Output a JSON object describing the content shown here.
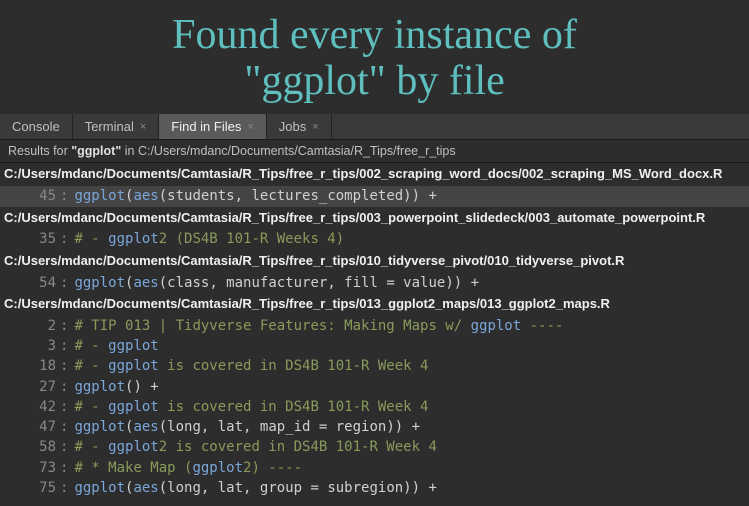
{
  "annotation": {
    "line1": "Found every instance of",
    "line2": "\"ggplot\" by file"
  },
  "tabs": [
    {
      "label": "Console",
      "closable": false,
      "active": false
    },
    {
      "label": "Terminal",
      "closable": true,
      "active": false
    },
    {
      "label": "Find in Files",
      "closable": true,
      "active": true
    },
    {
      "label": "Jobs",
      "closable": true,
      "active": false
    }
  ],
  "search": {
    "prefix": "Results for ",
    "query": "\"ggplot\"",
    "in": " in ",
    "path": "C:/Users/mdanc/Documents/Camtasia/R_Tips/free_r_tips"
  },
  "results": [
    {
      "file": "C:/Users/mdanc/Documents/Camtasia/R_Tips/free_r_tips/002_scraping_word_docs/002_scraping_MS_Word_docx.R",
      "lines": [
        {
          "n": 45,
          "highlight": true,
          "tokens": [
            {
              "t": "ggplot",
              "c": "fn"
            },
            {
              "t": "(",
              "c": "paren"
            },
            {
              "t": "aes",
              "c": "fn"
            },
            {
              "t": "(students, lectures_completed)) +",
              "c": "code"
            }
          ]
        }
      ]
    },
    {
      "file": "C:/Users/mdanc/Documents/Camtasia/R_Tips/free_r_tips/003_powerpoint_slidedeck/003_automate_powerpoint.R",
      "lines": [
        {
          "n": 35,
          "highlight": false,
          "tokens": [
            {
              "t": "# - ",
              "c": "cmt"
            },
            {
              "t": "ggplot",
              "c": "kw-match"
            },
            {
              "t": "2 (DS4B 101-R Weeks 4)",
              "c": "cmt"
            }
          ]
        }
      ]
    },
    {
      "file": "C:/Users/mdanc/Documents/Camtasia/R_Tips/free_r_tips/010_tidyverse_pivot/010_tidyverse_pivot.R",
      "lines": [
        {
          "n": 54,
          "highlight": false,
          "tokens": [
            {
              "t": "ggplot",
              "c": "fn"
            },
            {
              "t": "(",
              "c": "paren"
            },
            {
              "t": "aes",
              "c": "fn"
            },
            {
              "t": "(class, manufacturer, fill = value)) +",
              "c": "code"
            }
          ]
        }
      ]
    },
    {
      "file": "C:/Users/mdanc/Documents/Camtasia/R_Tips/free_r_tips/013_ggplot2_maps/013_ggplot2_maps.R",
      "lines": [
        {
          "n": 2,
          "highlight": false,
          "tokens": [
            {
              "t": "# TIP 013 | Tidyverse Features: Making Maps w/ ",
              "c": "cmt"
            },
            {
              "t": "ggplot",
              "c": "kw-match"
            },
            {
              "t": " ----",
              "c": "cmt"
            }
          ]
        },
        {
          "n": 3,
          "highlight": false,
          "tokens": [
            {
              "t": "# - ",
              "c": "cmt"
            },
            {
              "t": "ggplot",
              "c": "kw-match"
            }
          ]
        },
        {
          "n": 18,
          "highlight": false,
          "tokens": [
            {
              "t": "# - ",
              "c": "cmt"
            },
            {
              "t": "ggplot",
              "c": "kw-match"
            },
            {
              "t": " is covered in DS4B 101-R Week 4",
              "c": "cmt"
            }
          ]
        },
        {
          "n": 27,
          "highlight": false,
          "tokens": [
            {
              "t": "ggplot",
              "c": "fn"
            },
            {
              "t": "() +",
              "c": "code"
            }
          ]
        },
        {
          "n": 42,
          "highlight": false,
          "tokens": [
            {
              "t": "# - ",
              "c": "cmt"
            },
            {
              "t": "ggplot",
              "c": "kw-match"
            },
            {
              "t": " is covered in DS4B 101-R Week 4",
              "c": "cmt"
            }
          ]
        },
        {
          "n": 47,
          "highlight": false,
          "tokens": [
            {
              "t": "ggplot",
              "c": "fn"
            },
            {
              "t": "(",
              "c": "paren"
            },
            {
              "t": "aes",
              "c": "fn"
            },
            {
              "t": "(long, lat, map_id = region)) +",
              "c": "code"
            }
          ]
        },
        {
          "n": 58,
          "highlight": false,
          "tokens": [
            {
              "t": "# - ",
              "c": "cmt"
            },
            {
              "t": "ggplot",
              "c": "kw-match"
            },
            {
              "t": "2 is covered in DS4B 101-R Week 4",
              "c": "cmt"
            }
          ]
        },
        {
          "n": 73,
          "highlight": false,
          "tokens": [
            {
              "t": "# * Make Map (",
              "c": "cmt"
            },
            {
              "t": "ggplot",
              "c": "kw-match"
            },
            {
              "t": "2) ----",
              "c": "cmt"
            }
          ]
        },
        {
          "n": 75,
          "highlight": false,
          "tokens": [
            {
              "t": "ggplot",
              "c": "fn"
            },
            {
              "t": "(",
              "c": "paren"
            },
            {
              "t": "aes",
              "c": "fn"
            },
            {
              "t": "(long, lat, group = subregion)) +",
              "c": "code"
            }
          ]
        }
      ]
    }
  ]
}
